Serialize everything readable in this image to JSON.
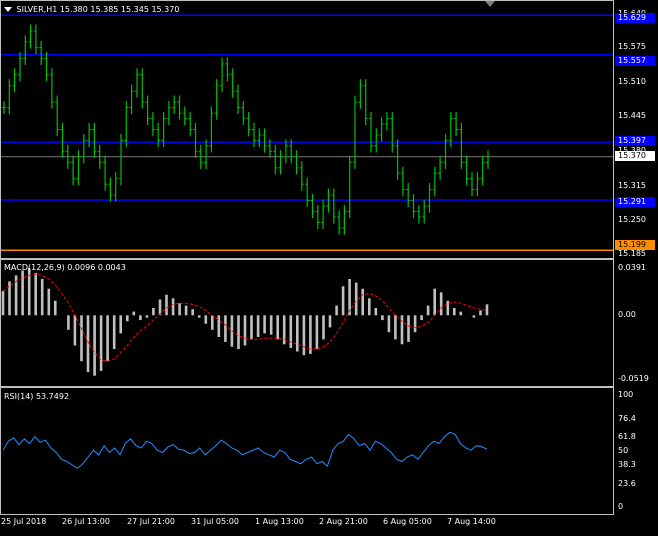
{
  "main": {
    "symbol_label": "SILVER,H1",
    "ohlc_label": "15.380 15.385 15.345 15.370",
    "price_axis": [
      "15.640",
      "15.575",
      "15.510",
      "15.445",
      "15.380",
      "15.315",
      "15.250",
      "15.185"
    ],
    "price_range": [
      15.185,
      15.655
    ],
    "current_price_tag": "15.370",
    "level_tags": [
      "15.629",
      "15.557",
      "15.397",
      "15.291",
      "15.199"
    ],
    "level_values": [
      15.629,
      15.557,
      15.397,
      15.291,
      15.199
    ],
    "colors": {
      "candle": "#00c000",
      "level_line": "#0000ff",
      "support_line": "#ff8c00",
      "current_line": "#c0c0c0"
    },
    "price_series": [
      15.46,
      15.5,
      15.52,
      15.55,
      15.58,
      15.6,
      15.57,
      15.55,
      15.52,
      15.47,
      15.42,
      15.38,
      15.36,
      15.33,
      15.37,
      15.4,
      15.42,
      15.38,
      15.36,
      15.32,
      15.3,
      15.33,
      15.4,
      15.46,
      15.49,
      15.52,
      15.47,
      15.44,
      15.42,
      15.4,
      15.44,
      15.46,
      15.47,
      15.45,
      15.44,
      15.42,
      15.38,
      15.36,
      15.39,
      15.45,
      15.5,
      15.54,
      15.52,
      15.49,
      15.46,
      15.44,
      15.42,
      15.4,
      15.41,
      15.39,
      15.38,
      15.35,
      15.37,
      15.39,
      15.37,
      15.35,
      15.32,
      15.29,
      15.27,
      15.25,
      15.28,
      15.3,
      15.26,
      15.24,
      15.27,
      15.36,
      15.47,
      15.5,
      15.44,
      15.39,
      15.41,
      15.43,
      15.44,
      15.39,
      15.34,
      15.31,
      15.29,
      15.27,
      15.26,
      15.28,
      15.31,
      15.34,
      15.36,
      15.4,
      15.44,
      15.42,
      15.36,
      15.33,
      15.31,
      15.33,
      15.36,
      15.37
    ]
  },
  "macd": {
    "label": "MACD(12,26,9) 0.0096 0.0043",
    "axis": [
      "0.0391",
      "0.00",
      "-0.0519"
    ],
    "range": [
      -0.0519,
      0.0391
    ],
    "histogram": [
      0.02,
      0.028,
      0.033,
      0.037,
      0.039,
      0.035,
      0.03,
      0.022,
      0.012,
      0.0,
      -0.012,
      -0.025,
      -0.038,
      -0.047,
      -0.05,
      -0.046,
      -0.038,
      -0.028,
      -0.015,
      -0.005,
      0.003,
      -0.004,
      -0.002,
      0.006,
      0.013,
      0.017,
      0.014,
      0.01,
      0.008,
      0.005,
      -0.002,
      -0.007,
      -0.012,
      -0.018,
      -0.022,
      -0.026,
      -0.028,
      -0.025,
      -0.02,
      -0.018,
      -0.015,
      -0.016,
      -0.02,
      -0.024,
      -0.027,
      -0.03,
      -0.033,
      -0.032,
      -0.028,
      -0.02,
      -0.01,
      0.008,
      0.024,
      0.03,
      0.027,
      0.022,
      0.014,
      0.006,
      -0.004,
      -0.014,
      -0.02,
      -0.024,
      -0.022,
      -0.014,
      -0.004,
      0.008,
      0.022,
      0.019,
      0.012,
      0.006,
      0.003,
      0.0,
      -0.002,
      0.004,
      0.009
    ],
    "signal": [
      0.02,
      0.024,
      0.028,
      0.031,
      0.033,
      0.034,
      0.033,
      0.03,
      0.025,
      0.018,
      0.01,
      0.0,
      -0.011,
      -0.022,
      -0.031,
      -0.037,
      -0.038,
      -0.036,
      -0.031,
      -0.025,
      -0.018,
      -0.013,
      -0.009,
      -0.004,
      0.001,
      0.006,
      0.009,
      0.01,
      0.01,
      0.009,
      0.007,
      0.004,
      0.0,
      -0.004,
      -0.008,
      -0.013,
      -0.017,
      -0.019,
      -0.02,
      -0.02,
      -0.019,
      -0.019,
      -0.019,
      -0.02,
      -0.022,
      -0.024,
      -0.026,
      -0.028,
      -0.028,
      -0.026,
      -0.022,
      -0.015,
      -0.006,
      0.004,
      0.012,
      0.017,
      0.018,
      0.016,
      0.012,
      0.006,
      0.0,
      -0.005,
      -0.009,
      -0.01,
      -0.009,
      -0.006,
      0.0,
      0.006,
      0.01,
      0.011,
      0.01,
      0.008,
      0.006,
      0.005,
      0.004
    ],
    "colors": {
      "histogram": "#c0c0c0",
      "signal": "#ff0000"
    }
  },
  "rsi": {
    "label": "RSI(14) 53.7492",
    "axis": [
      "100",
      "76.4",
      "61.8",
      "50",
      "38.3",
      "23.6",
      "0"
    ],
    "values": [
      52,
      60,
      63,
      57,
      62,
      58,
      64,
      59,
      61,
      54,
      50,
      44,
      42,
      39,
      36,
      40,
      46,
      52,
      48,
      56,
      50,
      54,
      48,
      58,
      62,
      56,
      54,
      60,
      58,
      52,
      50,
      55,
      57,
      53,
      52,
      49,
      50,
      54,
      48,
      52,
      56,
      61,
      58,
      54,
      52,
      48,
      50,
      52,
      54,
      50,
      48,
      46,
      52,
      50,
      44,
      42,
      40,
      44,
      46,
      40,
      42,
      38,
      52,
      58,
      60,
      66,
      62,
      56,
      58,
      52,
      60,
      58,
      54,
      50,
      44,
      42,
      46,
      48,
      44,
      50,
      56,
      60,
      58,
      64,
      68,
      66,
      58,
      54,
      52,
      56,
      55,
      53
    ],
    "colors": {
      "line": "#1e90ff"
    }
  },
  "time_axis": [
    "25 Jul 2018",
    "26 Jul 13:00",
    "27 Jul 21:00",
    "31 Jul 05:00",
    "1 Aug 13:00",
    "2 Aug 21:00",
    "6 Aug 05:00",
    "7 Aug 14:00"
  ]
}
